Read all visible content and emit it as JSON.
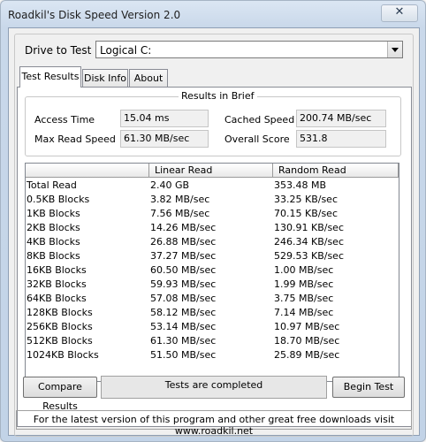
{
  "window": {
    "title": "Roadkil's Disk Speed Version 2.0",
    "close_glyph": "✕"
  },
  "drive": {
    "label": "Drive to Test",
    "selected": "Logical C:"
  },
  "tabs": [
    {
      "label": "Test Results"
    },
    {
      "label": "Disk Info"
    },
    {
      "label": "About"
    }
  ],
  "brief": {
    "legend": "Results in Brief",
    "access_time": {
      "label": "Access Time",
      "value": "15.04 ms"
    },
    "max_read_speed": {
      "label": "Max Read Speed",
      "value": "61.30 MB/sec"
    },
    "cached_speed": {
      "label": "Cached Speed",
      "value": "200.74 MB/sec"
    },
    "overall_score": {
      "label": "Overall Score",
      "value": "531.8"
    }
  },
  "table": {
    "columns": [
      "",
      "Linear Read",
      "Random Read"
    ],
    "rows": [
      [
        "Total Read",
        "2.40 GB",
        "353.48 MB"
      ],
      [
        "0.5KB Blocks",
        "3.82 MB/sec",
        "33.25 KB/sec"
      ],
      [
        "1KB Blocks",
        "7.56 MB/sec",
        "70.15 KB/sec"
      ],
      [
        "2KB Blocks",
        "14.26 MB/sec",
        "130.91 KB/sec"
      ],
      [
        "4KB Blocks",
        "26.88 MB/sec",
        "246.34 KB/sec"
      ],
      [
        "8KB Blocks",
        "37.27 MB/sec",
        "529.53 KB/sec"
      ],
      [
        "16KB Blocks",
        "60.50 MB/sec",
        "1.00 MB/sec"
      ],
      [
        "32KB Blocks",
        "59.93 MB/sec",
        "1.99 MB/sec"
      ],
      [
        "64KB Blocks",
        "57.08 MB/sec",
        "3.75 MB/sec"
      ],
      [
        "128KB Blocks",
        "58.12 MB/sec",
        "7.14 MB/sec"
      ],
      [
        "256KB Blocks",
        "53.14 MB/sec",
        "10.97 MB/sec"
      ],
      [
        "512KB Blocks",
        "61.30 MB/sec",
        "18.70 MB/sec"
      ],
      [
        "1024KB Blocks",
        "51.50 MB/sec",
        "25.89 MB/sec"
      ]
    ]
  },
  "buttons": {
    "compare": "Compare Results",
    "begin": "Begin Test"
  },
  "status": "Tests are completed",
  "footer": "For the latest version of this program and other great free downloads visit www.roadkil.net"
}
